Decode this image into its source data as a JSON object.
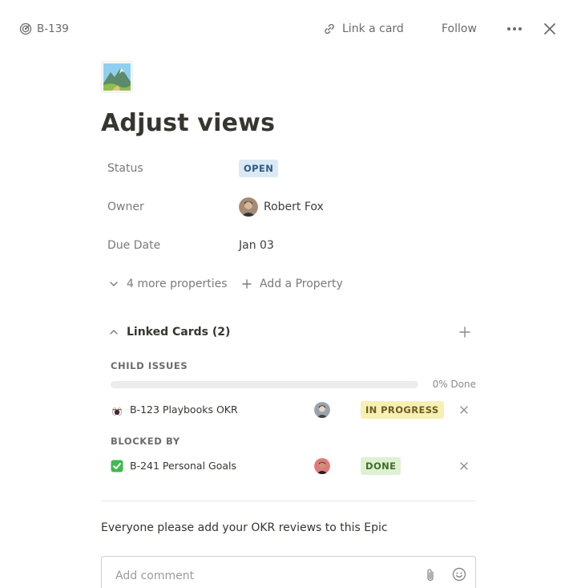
{
  "header": {
    "card_id": "B-139",
    "link_card_label": "Link a card",
    "follow_label": "Follow"
  },
  "card": {
    "icon": "mountain-landscape-image",
    "title": "Adjust views"
  },
  "properties": [
    {
      "label": "Status",
      "value": "OPEN"
    },
    {
      "label": "Owner",
      "value": "Robert Fox"
    },
    {
      "label": "Due Date",
      "value": "Jan 03"
    }
  ],
  "more_properties_label": "4 more properties",
  "add_property_label": "Add a Property",
  "linked_cards": {
    "header": "Linked Cards (2)",
    "child_issues_label": "CHILD ISSUES",
    "progress_percent": 0,
    "progress_text": "0% Done",
    "blocked_by_label": "BLOCKED BY",
    "child_issues": [
      {
        "icon": "bowling-pins-icon",
        "name": "B-123 Playbooks OKR",
        "status": "IN PROGRESS"
      }
    ],
    "blocked_by": [
      {
        "icon": "green-check-icon",
        "name": "B-241 Personal Goals",
        "status": "DONE"
      }
    ]
  },
  "description": "Everyone please add your OKR reviews to this Epic",
  "comment": {
    "placeholder": "Add comment",
    "value": ""
  },
  "colors": {
    "open_badge": "#dbe9f5",
    "in_progress_badge": "#f7f0b4",
    "done_badge": "#dff0d3"
  }
}
